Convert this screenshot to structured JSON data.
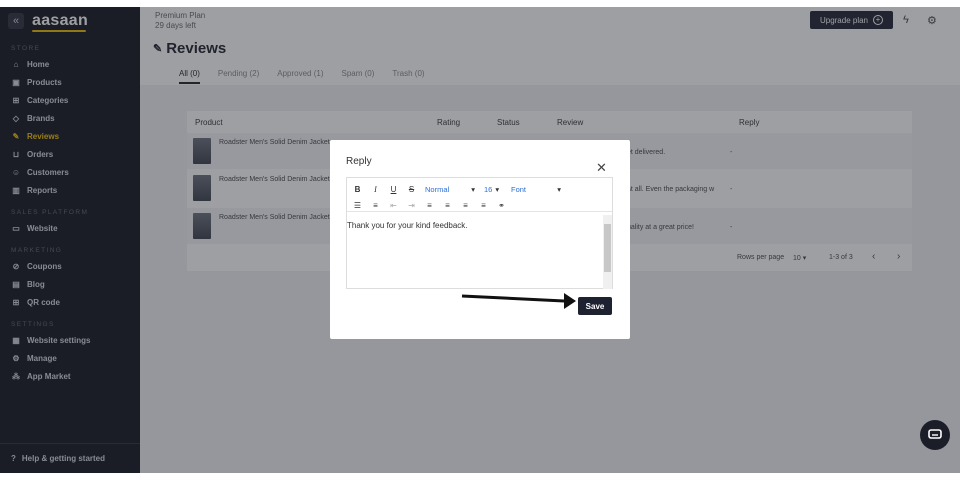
{
  "sidebar": {
    "logo": "aasaan",
    "collapse_icon": "«",
    "store_section": "STORE",
    "store_items": [
      {
        "label": "Home",
        "icon": "home-icon"
      },
      {
        "label": "Products",
        "icon": "products-icon"
      },
      {
        "label": "Categories",
        "icon": "categories-icon"
      },
      {
        "label": "Brands",
        "icon": "tag-icon"
      },
      {
        "label": "Reviews",
        "icon": "reviews-icon",
        "active": true
      },
      {
        "label": "Orders",
        "icon": "cart-icon"
      },
      {
        "label": "Customers",
        "icon": "users-icon"
      },
      {
        "label": "Reports",
        "icon": "chart-icon"
      }
    ],
    "sales_section": "SALES PLATFORM",
    "sales_items": [
      {
        "label": "Website",
        "icon": "monitor-icon"
      }
    ],
    "marketing_section": "MARKETING",
    "marketing_items": [
      {
        "label": "Coupons",
        "icon": "coupon-icon"
      },
      {
        "label": "Blog",
        "icon": "blog-icon"
      },
      {
        "label": "QR code",
        "icon": "qr-icon"
      }
    ],
    "settings_section": "SETTINGS",
    "settings_items": [
      {
        "label": "Website settings",
        "icon": "settings-icon"
      },
      {
        "label": "Manage",
        "icon": "gear-icon"
      },
      {
        "label": "App Market",
        "icon": "apps-icon"
      }
    ],
    "help": "Help & getting started"
  },
  "topbar": {
    "plan_name": "Premium Plan",
    "days_left": "29 days left",
    "upgrade_label": "Upgrade plan"
  },
  "page": {
    "title": "Reviews",
    "tabs": [
      "All (0)",
      "Pending (2)",
      "Approved (1)",
      "Spam (0)",
      "Trash (0)"
    ]
  },
  "table": {
    "headers": {
      "product": "Product",
      "rating": "Rating",
      "status": "Status",
      "review": "Review",
      "reply": "Reply"
    },
    "rows": [
      {
        "product": "Roadster Men's Solid Denim Jacket",
        "review": "et delivered.",
        "reply": "-"
      },
      {
        "product": "Roadster Men's Solid Denim Jacket",
        "review": "at all. Even the packaging w",
        "reply": "-"
      },
      {
        "product": "Roadster Men's Solid Denim Jacket",
        "review": "uality at a great price!",
        "reply": "-"
      }
    ],
    "rows_per_page_label": "Rows per page",
    "rows_per_page": "10",
    "range": "1-3 of 3"
  },
  "modal": {
    "title": "Reply",
    "format_select": "Normal",
    "size_select": "16",
    "font_select": "Font",
    "body_text": "Thank you for your kind feedback.",
    "save_label": "Save"
  },
  "colors": {
    "accent": "#f2c200",
    "dark": "#1e2130"
  }
}
